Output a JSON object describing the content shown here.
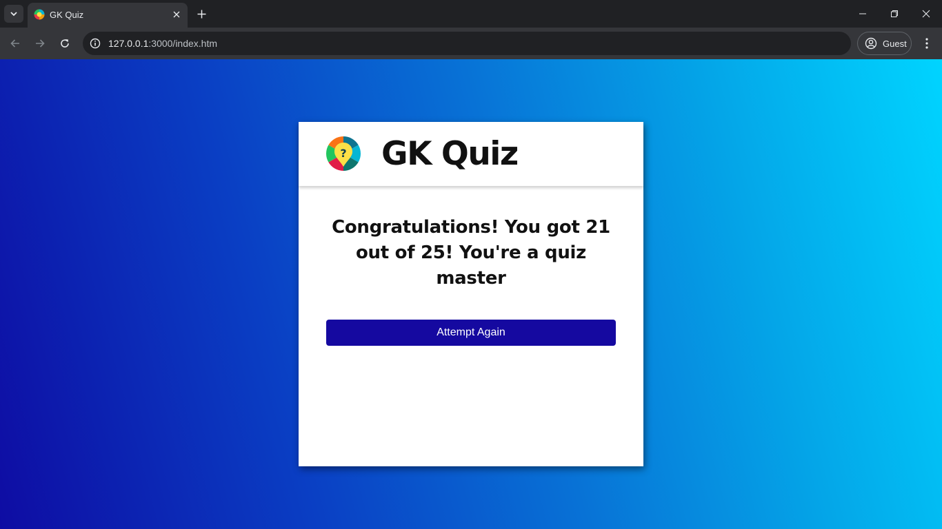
{
  "browser": {
    "tab_title": "GK Quiz",
    "url_host": "127.0.0.1",
    "url_path": ":3000/index.htm",
    "profile_label": "Guest"
  },
  "quiz": {
    "title": "GK Quiz",
    "result_message": "Congratulations! You got 21 out of 25! You're a quiz master",
    "attempt_again_label": "Attempt Again"
  },
  "colors": {
    "button": "#1509a0",
    "gradient_start": "#0e0ca3",
    "gradient_end": "#00d4ff"
  },
  "icons": [
    "tab-search-icon",
    "quiz-logo-icon",
    "close-icon",
    "plus-icon",
    "minimize-icon",
    "restore-icon",
    "back-icon",
    "forward-icon",
    "reload-icon",
    "site-info-icon",
    "profile-icon",
    "menu-icon"
  ]
}
